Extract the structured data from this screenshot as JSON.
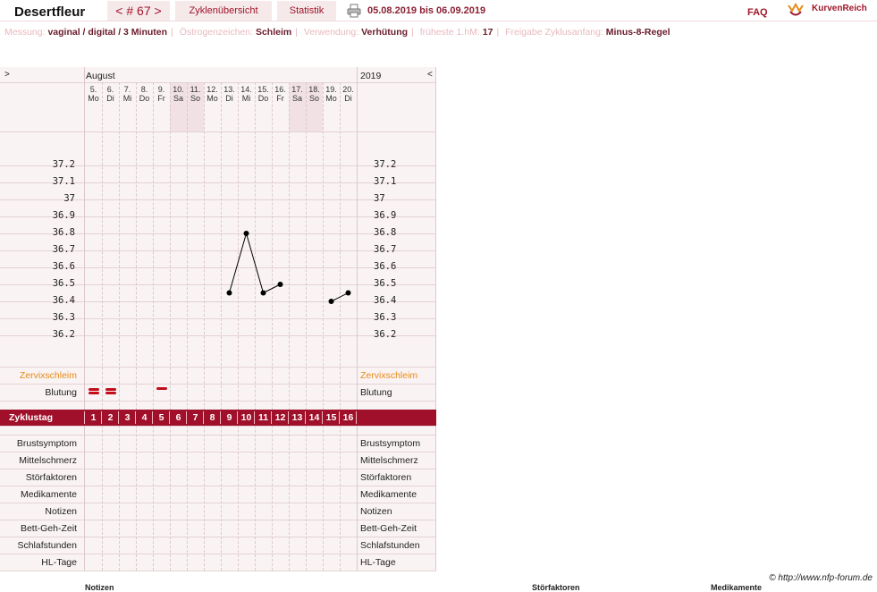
{
  "header": {
    "username": "Desertfleur",
    "cycle_nav": "< # 67 >",
    "overview_label": "Zyklenübersicht",
    "stats_label": "Statistik",
    "date_range": "05.08.2019 bis 06.09.2019",
    "faq": "FAQ",
    "logo_text": "KurvenReich"
  },
  "info": [
    {
      "key": "Messung:",
      "value": "vaginal / digital / 3 Minuten"
    },
    {
      "key": "Östrogenzeichen:",
      "value": "Schleim"
    },
    {
      "key": "Verwendung:",
      "value": "Verhütung"
    },
    {
      "key": "früheste 1.hM:",
      "value": "17"
    },
    {
      "key": "Freigabe Zyklusanfang:",
      "value": "Minus-8-Regel"
    }
  ],
  "chart": {
    "nav_left": ">",
    "nav_right": "<",
    "month": "August",
    "year": "2019",
    "days": [
      {
        "date": "5.",
        "weekday": "Mo",
        "weekend": false
      },
      {
        "date": "6.",
        "weekday": "Di",
        "weekend": false
      },
      {
        "date": "7.",
        "weekday": "Mi",
        "weekend": false
      },
      {
        "date": "8.",
        "weekday": "Do",
        "weekend": false
      },
      {
        "date": "9.",
        "weekday": "Fr",
        "weekend": false
      },
      {
        "date": "10.",
        "weekday": "Sa",
        "weekend": true
      },
      {
        "date": "11.",
        "weekday": "So",
        "weekend": true
      },
      {
        "date": "12.",
        "weekday": "Mo",
        "weekend": false
      },
      {
        "date": "13.",
        "weekday": "Di",
        "weekend": false
      },
      {
        "date": "14.",
        "weekday": "Mi",
        "weekend": false
      },
      {
        "date": "15.",
        "weekday": "Do",
        "weekend": false
      },
      {
        "date": "16.",
        "weekday": "Fr",
        "weekend": false
      },
      {
        "date": "17.",
        "weekday": "Sa",
        "weekend": true
      },
      {
        "date": "18.",
        "weekday": "So",
        "weekend": true
      },
      {
        "date": "19.",
        "weekday": "Mo",
        "weekend": false
      },
      {
        "date": "20.",
        "weekday": "Di",
        "weekend": false
      }
    ],
    "temp_ticks": [
      "37.2",
      "37.1",
      "37",
      "36.9",
      "36.8",
      "36.7",
      "36.6",
      "36.5",
      "36.4",
      "36.3",
      "36.2"
    ],
    "cervix_label": "Zervixschleim",
    "bleeding_label": "Blutung",
    "bleeding": [
      {
        "cycle_day": 1,
        "strength": 2
      },
      {
        "cycle_day": 2,
        "strength": 2
      },
      {
        "cycle_day": 5,
        "strength": 1
      }
    ],
    "cycle_day_label": "Zyklustag",
    "cycle_days": [
      "1",
      "2",
      "3",
      "4",
      "5",
      "6",
      "7",
      "8",
      "9",
      "10",
      "11",
      "12",
      "13",
      "14",
      "15",
      "16"
    ],
    "rows": [
      "Brustsymptom",
      "Mittelschmerz",
      "Störfaktoren",
      "Medikamente",
      "Notizen",
      "Bett-Geh-Zeit",
      "Schlafstunden",
      "HL-Tage"
    ]
  },
  "chart_data": {
    "type": "line",
    "x": [
      1,
      2,
      3,
      4,
      5,
      6,
      7,
      8,
      9,
      10,
      11,
      12,
      13,
      14,
      15,
      16
    ],
    "series": [
      {
        "values": [
          null,
          null,
          null,
          null,
          null,
          null,
          null,
          null,
          36.45,
          36.8,
          36.45,
          36.5,
          null,
          null,
          36.4,
          36.45
        ]
      }
    ],
    "ylim": [
      36.2,
      37.2
    ]
  },
  "footer": {
    "copyright": "© http://www.nfp-forum.de",
    "col1": "Notizen",
    "col2": "Störfaktoren",
    "col3": "Medikamente"
  }
}
